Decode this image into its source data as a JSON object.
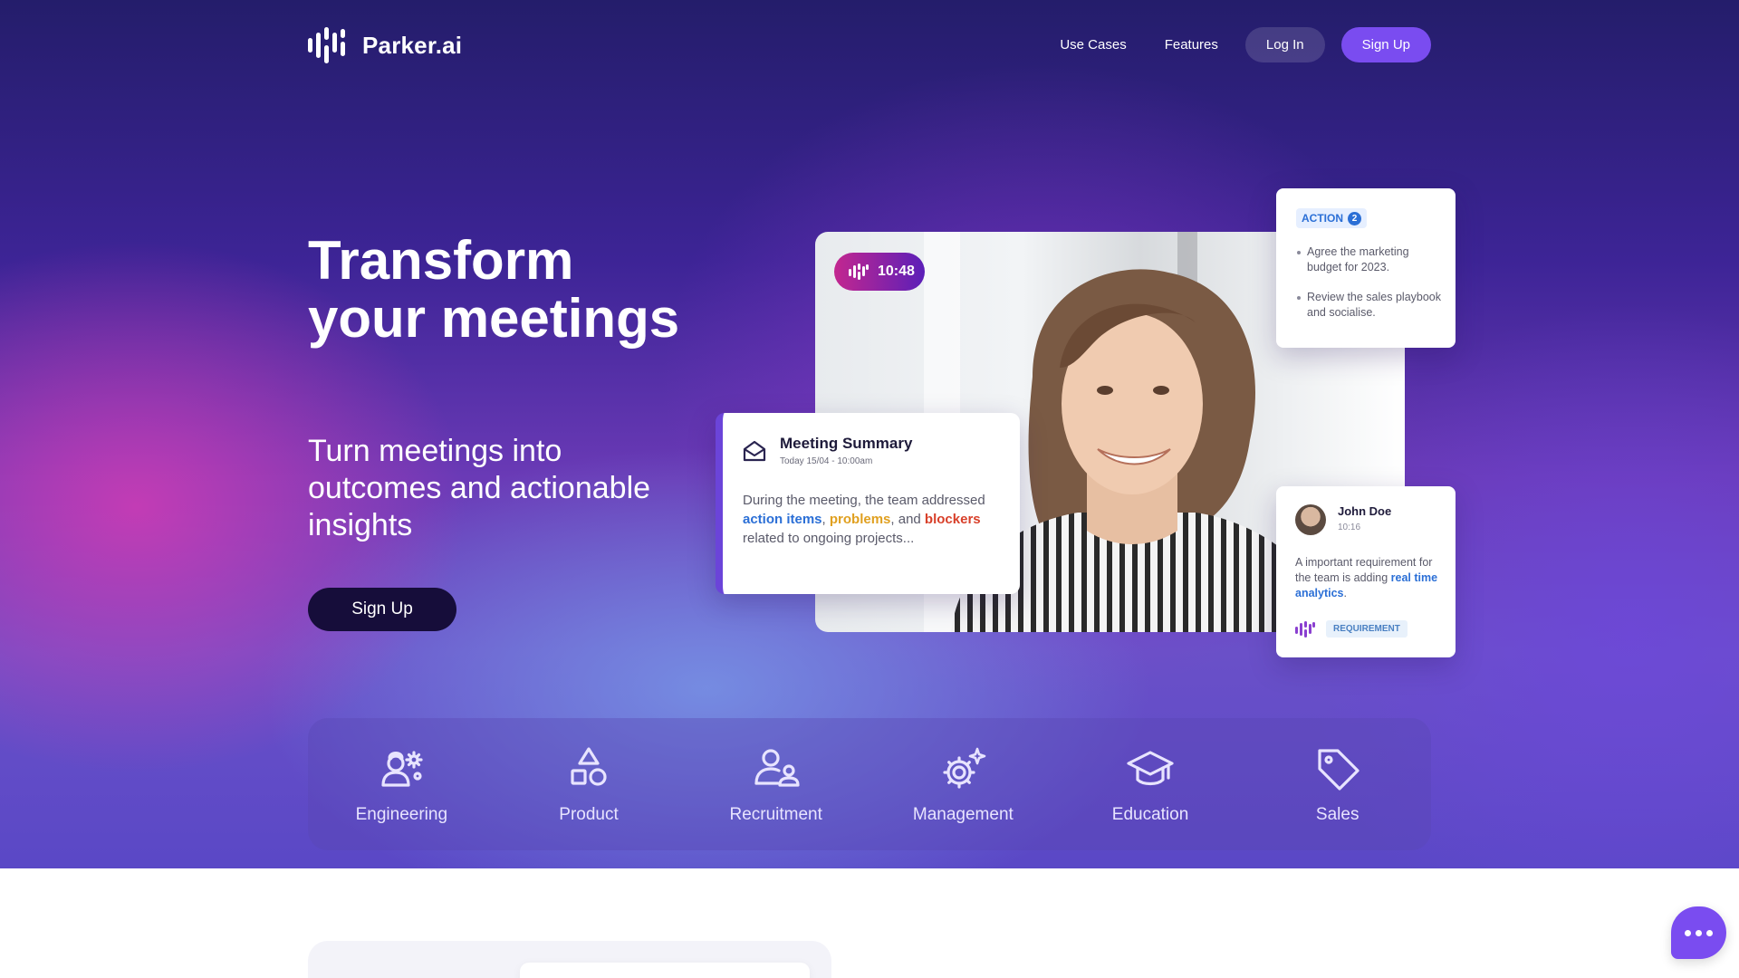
{
  "brand": {
    "name": "Parker.ai"
  },
  "nav": {
    "links": [
      "Use Cases",
      "Features"
    ],
    "login_label": "Log In",
    "signup_label": "Sign Up"
  },
  "hero": {
    "title": "Transform your meetings",
    "subtitle": "Turn meetings into outcomes and actionable insights",
    "cta_label": "Sign Up"
  },
  "video": {
    "timer": "10:48"
  },
  "summary_card": {
    "title": "Meeting Summary",
    "date": "Today 15/04 - 10:00am",
    "body_1": "During the meeting, the team addressed ",
    "kw_1": "action items",
    "sep_1": ", ",
    "kw_2": "problems",
    "sep_2": ", and ",
    "kw_3": "blockers",
    "body_2": " related to ongoing projects..."
  },
  "action_card": {
    "badge": "ACTION",
    "count": "2",
    "items": [
      "Agree the marketing budget for 2023.",
      "Review the sales playbook and socialise."
    ]
  },
  "comment_card": {
    "name": "John Doe",
    "time": "10:16",
    "body": "A important requirement for the team is adding ",
    "highlight": "real time analytics",
    "tail": ".",
    "tag": "REQUIREMENT"
  },
  "use_cases": [
    {
      "label": "Engineering",
      "icon": "engineering-icon"
    },
    {
      "label": "Product",
      "icon": "product-icon"
    },
    {
      "label": "Recruitment",
      "icon": "recruitment-icon"
    },
    {
      "label": "Management",
      "icon": "management-icon"
    },
    {
      "label": "Education",
      "icon": "education-icon"
    },
    {
      "label": "Sales",
      "icon": "sales-icon"
    }
  ],
  "colors": {
    "accent": "#7a4cf0",
    "dark_button": "#160d3a",
    "keyword_blue": "#2b6fd6",
    "keyword_yellow": "#e0a020",
    "keyword_red": "#d8402a"
  }
}
